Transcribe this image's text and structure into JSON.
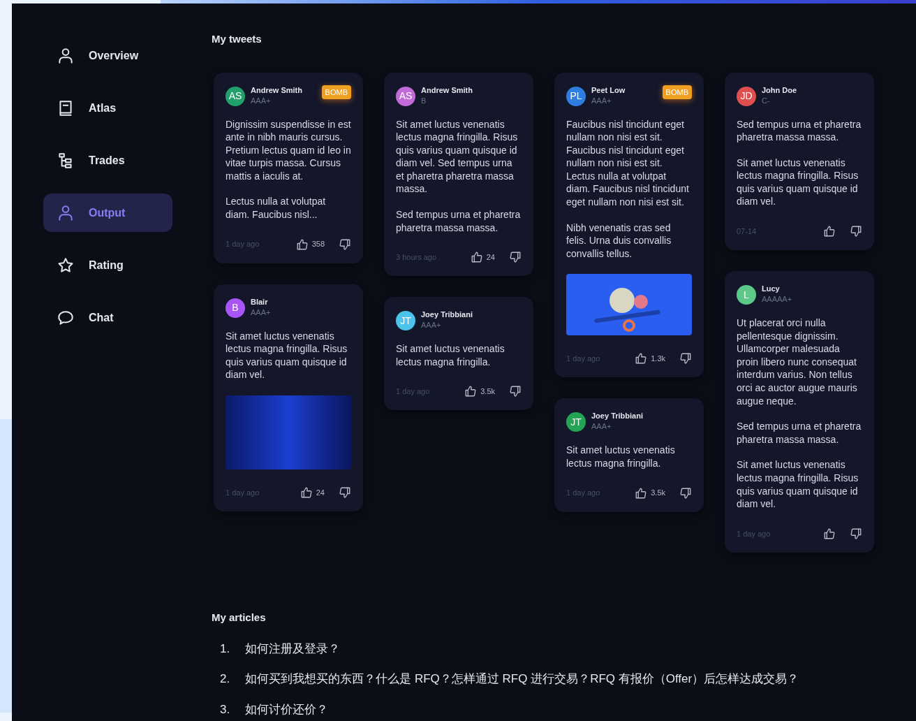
{
  "sidebar": {
    "items": [
      {
        "label": "Overview",
        "kind": "person",
        "selected": false
      },
      {
        "label": "Atlas",
        "kind": "book",
        "selected": false
      },
      {
        "label": "Trades",
        "kind": "tree",
        "selected": false
      },
      {
        "label": "Output",
        "kind": "person",
        "selected": true
      },
      {
        "label": "Rating",
        "kind": "star",
        "selected": false
      },
      {
        "label": "Chat",
        "kind": "chat",
        "selected": false
      }
    ]
  },
  "tweets": {
    "title": "My tweets",
    "columns": [
      [
        {
          "initials": "AS",
          "color": "#22a06b",
          "name": "Andrew Smith",
          "rating": "AAA+",
          "badge": "BOMB",
          "paragraphs": [
            "Dignissim suspendisse in est ante in nibh mauris cursus. Pretium lectus quam id leo in vitae turpis massa. Cursus mattis a iaculis at.",
            "Lectus nulla at volutpat diam. Faucibus nisl..."
          ],
          "time": "1 day ago",
          "likes": "358"
        },
        {
          "initials": "B",
          "color": "#a855f7",
          "name": "Blair",
          "rating": "AAA+",
          "paragraphs": [
            "Sit amet luctus venenatis lectus magna fringilla. Risus quis varius quam quisque id diam vel."
          ],
          "kind": "photo",
          "time": "1 day ago",
          "likes": "24"
        }
      ],
      [
        {
          "initials": "AS",
          "color": "#c26ad8",
          "name": "Andrew Smith",
          "rating": "B",
          "paragraphs": [
            "Sit amet luctus venenatis lectus magna fringilla. Risus quis varius quam quisque id diam vel. Sed tempus urna et pharetra pharetra massa massa.",
            "Sed tempus urna et pharetra pharetra massa massa."
          ],
          "time": "3 hours ago",
          "likes": "24"
        },
        {
          "initials": "JT",
          "color": "#4cc3ea",
          "name": "Joey Tribbiani",
          "rating": "AAA+",
          "paragraphs": [
            "Sit amet luctus venenatis lectus magna fringilla."
          ],
          "time": "1 day ago",
          "likes": "3.5k"
        }
      ],
      [
        {
          "initials": "PL",
          "color": "#2f7de1",
          "name": "Peet Low",
          "rating": "AAA+",
          "badge": "BOMB",
          "paragraphs": [
            "Faucibus nisl tincidunt eget nullam non nisi est sit. Faucibus nisl tincidunt eget nullam non nisi est sit. Lectus nulla at volutpat diam. Faucibus nisl tincidunt eget nullam non nisi est sit.",
            "Nibh venenatis cras sed felis. Urna duis convallis convallis tellus."
          ],
          "kind": "illustration",
          "time": "1 day ago",
          "likes": "1.3k"
        },
        {
          "initials": "JT",
          "color": "#23a354",
          "name": "Joey Tribbiani",
          "rating": "AAA+",
          "paragraphs": [
            "Sit amet luctus venenatis lectus magna fringilla."
          ],
          "time": "1 day ago",
          "likes": "3.5k"
        }
      ],
      [
        {
          "initials": "JD",
          "color": "#e04f4f",
          "name": "John Doe",
          "rating": "C-",
          "paragraphs": [
            "Sed tempus urna et pharetra pharetra massa massa.",
            "Sit amet luctus venenatis lectus magna fringilla. Risus quis varius quam quisque id diam vel."
          ],
          "time": "07-14"
        },
        {
          "initials": "L",
          "color": "#5cc98a",
          "name": "Lucy",
          "rating": "AAAAA+",
          "paragraphs": [
            "Ut placerat orci nulla pellentesque dignissim. Ullamcorper malesuada proin libero nunc consequat interdum varius. Non tellus orci ac auctor augue mauris augue neque.",
            "Sed tempus urna et pharetra pharetra massa massa.",
            "Sit amet luctus venenatis lectus magna fringilla. Risus quis varius quam quisque id diam vel."
          ],
          "time": "1 day ago"
        }
      ]
    ]
  },
  "articles": {
    "title": "My articles",
    "items": [
      {
        "number": "1.",
        "title": "如何注册及登录？"
      },
      {
        "number": "2.",
        "title": "如何买到我想买的东西？什么是 RFQ？怎样通过 RFQ 进行交易？RFQ 有报价（Offer）后怎样达成交易？"
      },
      {
        "number": "3.",
        "title": "如何讨价还价？"
      }
    ]
  }
}
